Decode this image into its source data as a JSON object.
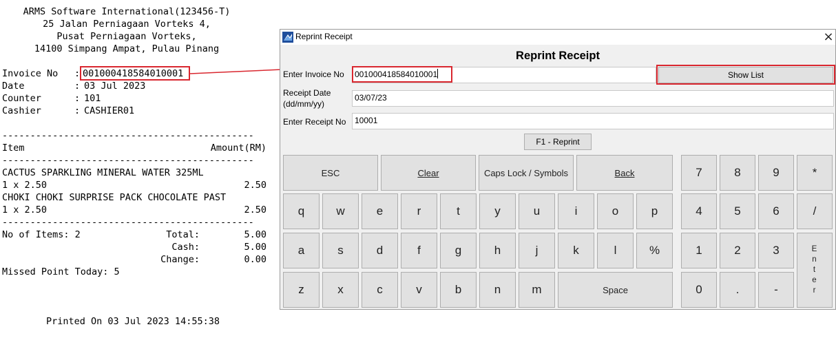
{
  "receipt": {
    "header": [
      "ARMS Software International(123456-T)",
      "25 Jalan Perniagaan Vorteks 4,",
      "Pusat Perniagaan Vorteks,",
      "14100 Simpang Ampat, Pulau Pinang"
    ],
    "invoice_label": "Invoice No",
    "invoice_value": "001000418584010001",
    "date_label": "Date",
    "date_value": "03 Jul 2023",
    "counter_label": "Counter",
    "counter_value": "101",
    "cashier_label": "Cashier",
    "cashier_value": "CASHIER01",
    "separator": "---------------------------------------------",
    "item_header": "Item",
    "amount_header": "Amount(RM)",
    "items": [
      {
        "name": "CACTUS SPARKLING MINERAL WATER 325ML",
        "qty": "1 x 2.50",
        "amount": "2.50"
      },
      {
        "name": "CHOKI CHOKI SURPRISE PACK CHOCOLATE PAST",
        "qty": "1 x 2.50",
        "amount": "2.50"
      }
    ],
    "no_of_items": "No of Items: 2",
    "total_label": "Total:",
    "total_value": "5.00",
    "cash_label": "Cash:",
    "cash_value": "5.00",
    "change_label": "Change:",
    "change_value": "0.00",
    "missed_point": "Missed Point Today: 5",
    "printed_on": "Printed On 03 Jul 2023 14:55:38"
  },
  "colors": {
    "highlight": "#d9262e"
  },
  "dialog": {
    "window_title": "Reprint Receipt",
    "heading": "Reprint Receipt",
    "invoice_label": "Enter Invoice No",
    "invoice_value": "001000418584010001",
    "show_list_label": "Show List",
    "receipt_date_label_1": "Receipt Date",
    "receipt_date_label_2": "(dd/mm/yy)",
    "receipt_date_value": "03/07/23",
    "receipt_no_label": "Enter Receipt No",
    "receipt_no_value": "10001",
    "reprint_button_label": "F1 - Reprint",
    "icons": {
      "app": "app-icon",
      "close": "close-icon"
    }
  },
  "keyboard": {
    "esc": "ESC",
    "clear": "Clear",
    "caps": "Caps Lock / Symbols",
    "back": "Back",
    "row1": [
      "q",
      "w",
      "e",
      "r",
      "t",
      "y",
      "u",
      "i",
      "o",
      "p"
    ],
    "row2": [
      "a",
      "s",
      "d",
      "f",
      "g",
      "h",
      "j",
      "k",
      "l",
      "%"
    ],
    "row3": [
      "z",
      "x",
      "c",
      "v",
      "b",
      "n",
      "m"
    ],
    "space": "Space",
    "numpad": [
      "7",
      "8",
      "9",
      "*",
      "4",
      "5",
      "6",
      "/",
      "1",
      "2",
      "3",
      "0",
      ".",
      "-"
    ],
    "enter": [
      "E",
      "n",
      "t",
      "e",
      "r"
    ]
  }
}
